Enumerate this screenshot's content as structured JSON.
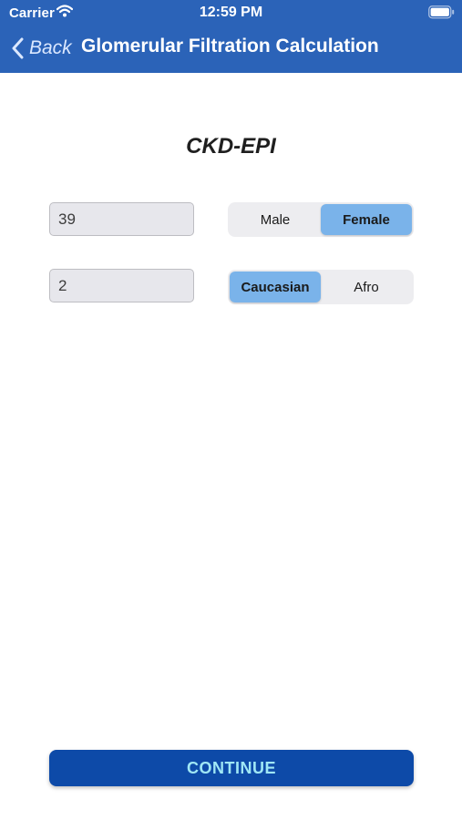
{
  "status_bar": {
    "carrier": "Carrier",
    "time": "12:59 PM",
    "wifi_icon": "wifi-icon",
    "battery_icon": "battery-icon"
  },
  "nav": {
    "back_label": "Back",
    "back_icon": "chevron-left-icon",
    "title": "Glomerular Filtration Calculation"
  },
  "form": {
    "title": "CKD-EPI",
    "age_value": "39",
    "creatinine_value": "2",
    "sex_options": [
      {
        "label": "Male",
        "selected": false
      },
      {
        "label": "Female",
        "selected": true
      }
    ],
    "race_options": [
      {
        "label": "Caucasian",
        "selected": true
      },
      {
        "label": "Afro",
        "selected": false
      }
    ]
  },
  "continue_label": "CONTINUE",
  "colors": {
    "header": "#2b63b8",
    "segment_selected": "#7ab3ea",
    "button": "#0d4aa8",
    "button_text": "#9fe7f5"
  }
}
